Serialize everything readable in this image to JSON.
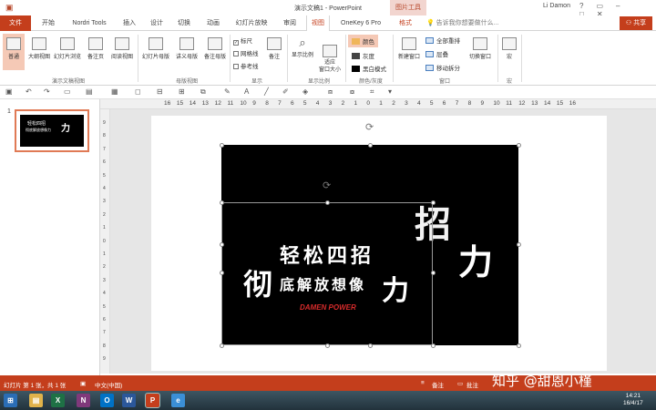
{
  "window": {
    "title": "演示文稿1 - PowerPoint",
    "contextual_tab": "图片工具",
    "user": "Li Damon",
    "qat_icon": "powerpoint-icon",
    "controls": [
      "?",
      "▭",
      "–",
      "□",
      "✕"
    ]
  },
  "tabs": [
    {
      "label": "文件"
    },
    {
      "label": "开始"
    },
    {
      "label": "Nordri Tools"
    },
    {
      "label": "插入"
    },
    {
      "label": "设计"
    },
    {
      "label": "切换"
    },
    {
      "label": "动画"
    },
    {
      "label": "幻灯片放映"
    },
    {
      "label": "审阅"
    },
    {
      "label": "视图"
    },
    {
      "label": "OneKey 6 Pro"
    },
    {
      "label": "格式"
    }
  ],
  "active_tab": "视图",
  "search": {
    "placeholder": "告诉我你想要做什么..."
  },
  "share_label": "共享",
  "ribbon": {
    "presentation_views": {
      "group_label": "演示文稿视图",
      "buttons": [
        "普通",
        "大纲视图",
        "幻灯片浏览",
        "备注页",
        "阅读视图"
      ],
      "selected": "普通"
    },
    "master_views": {
      "group_label": "母版视图",
      "buttons": [
        "幻灯片母版",
        "讲义母版",
        "备注母版"
      ]
    },
    "show": {
      "group_label": "显示",
      "checks": [
        {
          "label": "标尺",
          "checked": true
        },
        {
          "label": "网格线",
          "checked": false
        },
        {
          "label": "参考线",
          "checked": false
        }
      ],
      "notes_button": "备注"
    },
    "zoom": {
      "group_label": "显示比例",
      "buttons": [
        "显示比例",
        "适应\n窗口大小"
      ]
    },
    "color": {
      "group_label": "颜色/灰度",
      "options": [
        {
          "label": "颜色",
          "swatch": "#f0b65a",
          "selected": true
        },
        {
          "label": "灰度",
          "swatch": "#444444",
          "selected": false
        },
        {
          "label": "黑白模式",
          "swatch": "#000000",
          "selected": false
        }
      ]
    },
    "window": {
      "group_label": "窗口",
      "new_window": "新建窗口",
      "small_buttons": [
        "全部重排",
        "层叠",
        "移动拆分"
      ],
      "switch_window": "切换窗口"
    },
    "macro": {
      "group_label": "宏",
      "button": "宏"
    }
  },
  "ruler": {
    "horizontal": [
      "16",
      "15",
      "14",
      "13",
      "12",
      "11",
      "10",
      "9",
      "8",
      "7",
      "6",
      "5",
      "4",
      "3",
      "2",
      "1",
      "0",
      "1",
      "2",
      "3",
      "4",
      "5",
      "6",
      "7",
      "8",
      "9",
      "10",
      "11",
      "12",
      "13",
      "14",
      "15",
      "16"
    ],
    "vertical": [
      "9",
      "8",
      "7",
      "6",
      "5",
      "4",
      "3",
      "2",
      "1",
      "0",
      "1",
      "2",
      "3",
      "4",
      "5",
      "6",
      "7",
      "8",
      "9"
    ]
  },
  "thumbnail": {
    "number": "1",
    "text_line1": "轻松四招",
    "text_line2": "彻底解放想像力"
  },
  "slide": {
    "line1": "轻松四招",
    "line2_first": "彻",
    "line2_mid": "底解放想像",
    "line2_last": "力",
    "brand": "DAMEN POWER",
    "brand_color": "#d92b2b",
    "ghost_chars": [
      "招",
      "力"
    ]
  },
  "status": {
    "slide_info": "幻灯片 第 1 张，共 1 张",
    "language": "中文(中国)",
    "notes": "备注",
    "comments": "批注"
  },
  "taskbar": {
    "icons": [
      {
        "name": "start-icon",
        "color": "#2a6db5",
        "glyph": "⊞"
      },
      {
        "name": "explorer-icon",
        "color": "#e0b24a",
        "glyph": "▤"
      },
      {
        "name": "excel-icon",
        "color": "#1e7145",
        "glyph": "X"
      },
      {
        "name": "onenote-icon",
        "color": "#80397b",
        "glyph": "N"
      },
      {
        "name": "outlook-icon",
        "color": "#0072c6",
        "glyph": "O"
      },
      {
        "name": "word-icon",
        "color": "#2b579a",
        "glyph": "W"
      },
      {
        "name": "powerpoint-icon",
        "color": "#c43e1c",
        "glyph": "P"
      },
      {
        "name": "ie-icon",
        "color": "#3b8fd6",
        "glyph": "e"
      }
    ],
    "time": "14:21",
    "date": "16/4/17"
  },
  "watermark": "知乎 @甜恩小槿"
}
